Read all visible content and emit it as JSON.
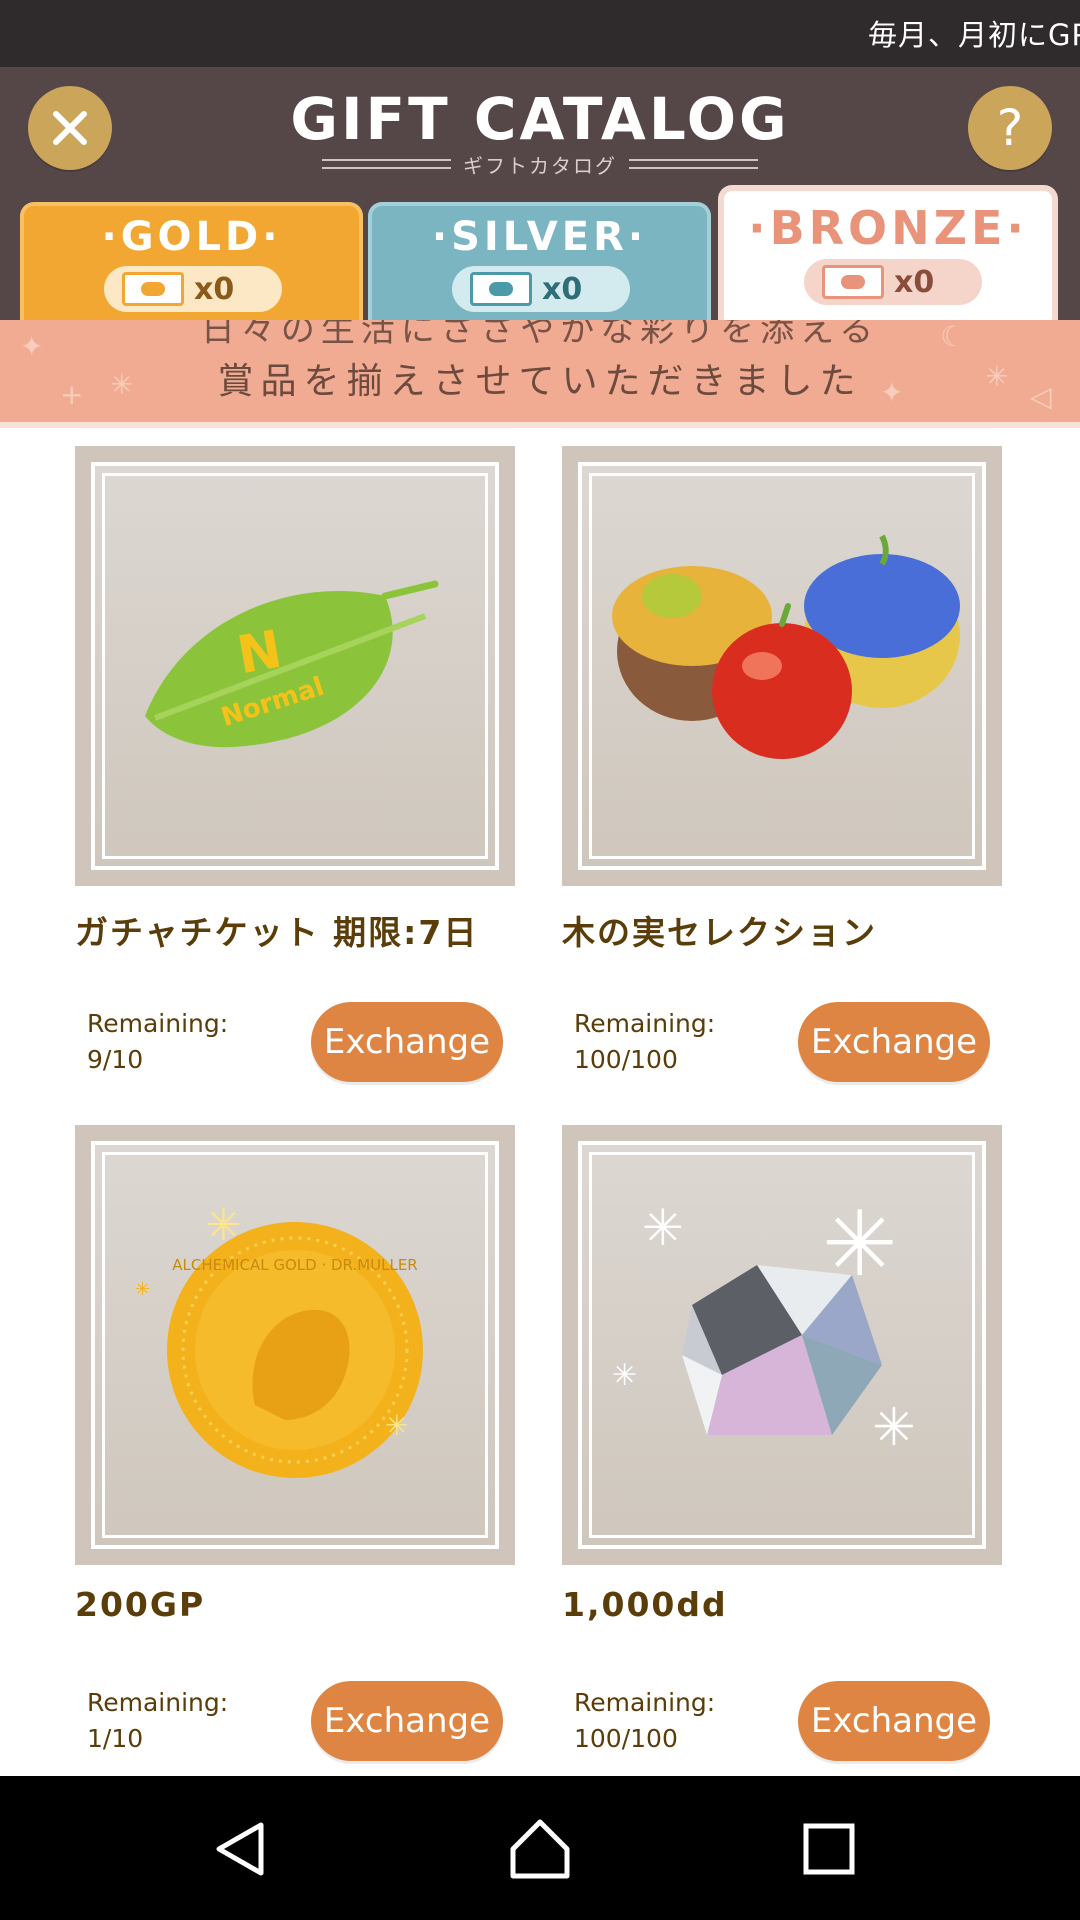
{
  "ticker": {
    "text": "毎月、月初にGPと"
  },
  "header": {
    "title": "GIFT CATALOG",
    "subtitle": "ギフトカタログ",
    "close_icon": "close-icon",
    "help_label": "?"
  },
  "tabs": [
    {
      "label": "·GOLD·",
      "count": "x0",
      "color": "#f2a733"
    },
    {
      "label": "·SILVER·",
      "count": "x0",
      "color": "#7bb5c2"
    },
    {
      "label": "·BRONZE·",
      "count": "x0",
      "color": "#e9947a",
      "selected": true
    }
  ],
  "banner": {
    "line1": "日々の生活にささやかな彩りを添える",
    "line2": "賞品を揃えさせていただきました"
  },
  "items": [
    {
      "name": "ガチャチケット 期限:7日",
      "remaining_label": "Remaining:",
      "remaining_value": "9/10",
      "button": "Exchange",
      "icon": "leaf-ticket-icon",
      "image_text": "Normal"
    },
    {
      "name": "木の実セレクション",
      "remaining_label": "Remaining:",
      "remaining_value": "100/100",
      "button": "Exchange",
      "icon": "fruits-icon"
    },
    {
      "name": "200GP",
      "remaining_label": "Remaining:",
      "remaining_value": "1/10",
      "button": "Exchange",
      "icon": "gold-coin-icon",
      "image_text": "ALCHEMICAL GOLD · DR.MULLER"
    },
    {
      "name": "1,000dd",
      "remaining_label": "Remaining:",
      "remaining_value": "100/100",
      "button": "Exchange",
      "icon": "diamond-icon"
    }
  ],
  "navbar": {
    "buttons": [
      "back-icon",
      "home-icon",
      "recents-icon"
    ]
  },
  "colors": {
    "accent": "#de8543",
    "header_bg": "#554647",
    "text_brown": "#5a3d08"
  }
}
